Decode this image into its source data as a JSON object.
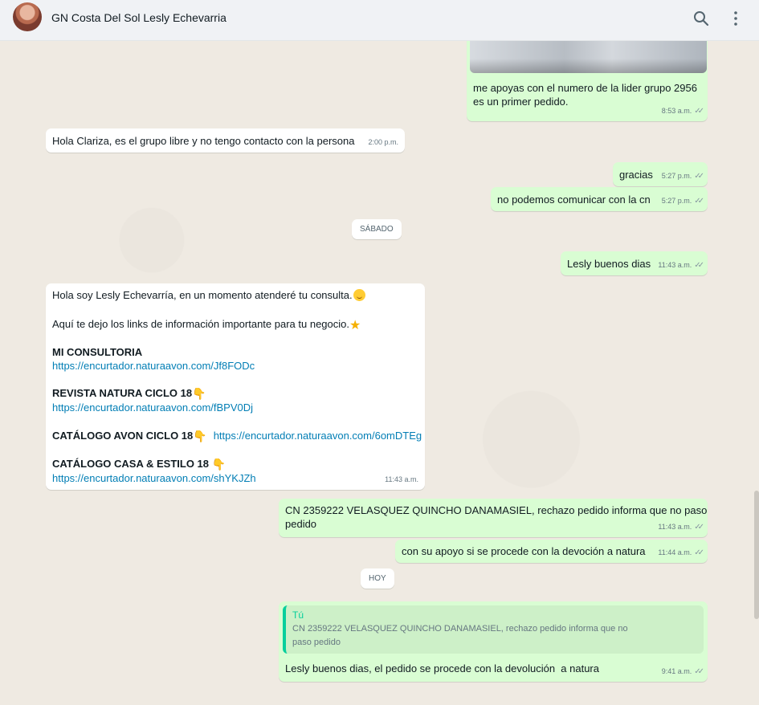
{
  "header": {
    "contact_name": "GN Costa Del Sol Lesly Echevarria",
    "icons": [
      "avatar",
      "search-icon",
      "menu-icon"
    ]
  },
  "messages": {
    "m1": {
      "text": "me apoyas con el numero de la lider grupo 2956\nes un primer pedido.",
      "time": "8:53 a.m."
    },
    "m2": {
      "text": "Hola Clariza, es el grupo libre y no tengo contacto con la persona",
      "time": "2:00 p.m."
    },
    "m3": {
      "text": "gracias",
      "time": "5:27 p.m."
    },
    "m4": {
      "text": "no podemos comunicar con la cn",
      "time": "5:27 p.m."
    },
    "date1": "SÁBADO",
    "m5": {
      "text": "Lesly buenos dias",
      "time": "11:43 a.m."
    },
    "m6": {
      "line1": "Hola soy Lesly Echevarría, en un momento atenderé tu consulta.",
      "line2": "Aquí te dejo los links de información importante para tu negocio.",
      "h1": "MI CONSULTORIA",
      "l1": "https://encurtador.naturaavon.com/Jf8FODc",
      "h2": "REVISTA NATURA CICLO 18",
      "l2": "https://encurtador.naturaavon.com/fBPV0Dj",
      "h3": "CATÁLOGO AVON CICLO 18",
      "l3": "https://encurtador.naturaavon.com/6omDTEg",
      "h4": "CATÁLOGO CASA & ESTILO 18",
      "l4": "https://encurtador.naturaavon.com/shYKJZh",
      "time": "11:43 a.m."
    },
    "m7": {
      "text": "CN 2359222 VELASQUEZ QUINCHO DANAMASIEL, rechazo pedido informa que no paso\npedido",
      "time": "11:43 a.m."
    },
    "m8": {
      "text": "con su apoyo si se procede con la devoción a natura",
      "time": "11:44 a.m."
    },
    "date2": "HOY",
    "m9": {
      "quote_author": "Tú",
      "quote_text": "CN 2359222 VELASQUEZ QUINCHO DANAMASIEL, rechazo pedido informa que no\npaso pedido",
      "text": "Lesly buenos dias, el pedido se procede con la devolución  a natura",
      "time": "9:41 a.m."
    }
  },
  "colors": {
    "outgoing": "#d9fdd3",
    "incoming": "#ffffff",
    "link": "#027eb5",
    "quote_bar": "#06cf9c"
  }
}
